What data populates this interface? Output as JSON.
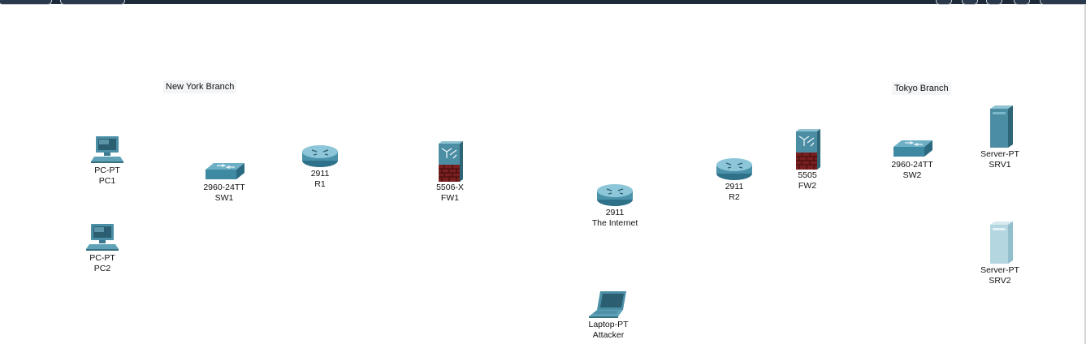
{
  "areas": {
    "new_york": "New York Branch",
    "tokyo": "Tokyo Branch"
  },
  "devices": {
    "pc1": {
      "model": "PC-PT",
      "name": "PC1",
      "icon": "pc-icon"
    },
    "pc2": {
      "model": "PC-PT",
      "name": "PC2",
      "icon": "pc-icon"
    },
    "sw1": {
      "model": "2960-24TT",
      "name": "SW1",
      "icon": "switch-icon"
    },
    "r1": {
      "model": "2911",
      "name": "R1",
      "icon": "router-icon"
    },
    "fw1": {
      "model": "5506-X",
      "name": "FW1",
      "icon": "firewall-icon"
    },
    "internet": {
      "model": "2911",
      "name": "The Internet",
      "icon": "router-icon"
    },
    "laptop": {
      "model": "Laptop-PT",
      "name": "Attacker",
      "icon": "laptop-icon"
    },
    "r2": {
      "model": "2911",
      "name": "R2",
      "icon": "router-icon"
    },
    "fw2": {
      "model": "5505",
      "name": "FW2",
      "icon": "firewall-icon"
    },
    "sw2": {
      "model": "2960-24TT",
      "name": "SW2",
      "icon": "switch-icon"
    },
    "srv1": {
      "model": "Server-PT",
      "name": "SRV1",
      "icon": "server-icon"
    },
    "srv2": {
      "model": "Server-PT",
      "name": "SRV2",
      "icon": "server-icon"
    }
  }
}
